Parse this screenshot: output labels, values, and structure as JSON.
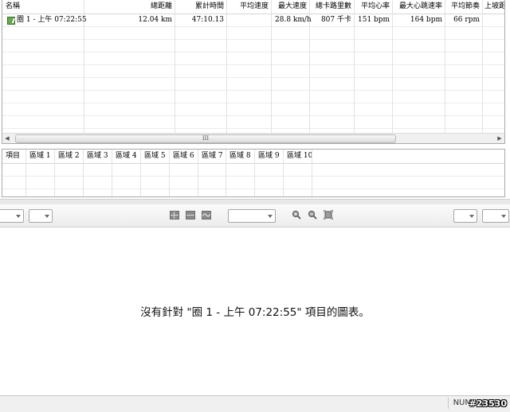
{
  "laps": {
    "columns": [
      "名稱",
      "總距離",
      "累計時間",
      "平均速度",
      "最大速度",
      "總卡路里數",
      "平均心率",
      "最大心跳速率",
      "平均節奏",
      "上坡距"
    ],
    "rows": [
      {
        "name": "圈 1 - 上午 07:22:55",
        "distance": "12.04 km",
        "elapsed": "47:10.13",
        "avg_speed": "",
        "max_speed": "28.8 km/h",
        "calories": "807 千卡",
        "avg_hr": "151 bpm",
        "max_hr": "164 bpm",
        "avg_cadence": "66 rpm",
        "ascent": ""
      }
    ],
    "scroll_thumb_glyph": "III"
  },
  "zones": {
    "columns": [
      "項目",
      "區域 1",
      "區域 2",
      "區域 3",
      "區域 4",
      "區域 5",
      "區域 6",
      "區域 7",
      "區域 8",
      "區域 9",
      "區域 10"
    ]
  },
  "chart": {
    "message": "沒有針對 \"圈 1 - 上午 07:22:55\" 項目的圖表。"
  },
  "status": {
    "num": "NUM",
    "watermark": "#23530"
  },
  "icons": {
    "lap": "lap-icon",
    "grid": "grid-icon",
    "zoom_in": "zoom-in-icon",
    "zoom_out": "zoom-out-icon",
    "fit": "zoom-fit-icon"
  }
}
